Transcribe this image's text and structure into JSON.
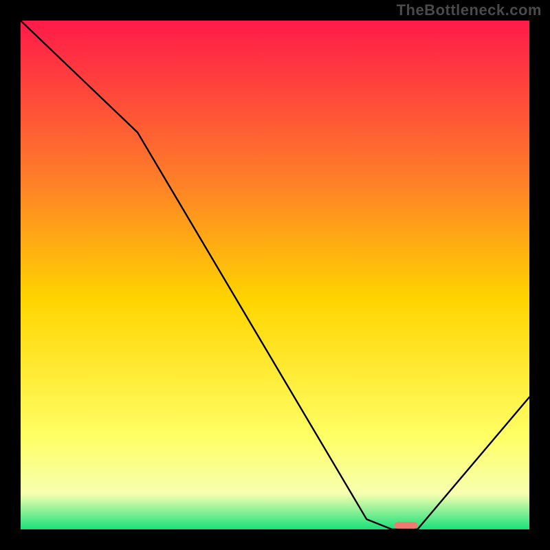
{
  "watermark": "TheBottleneck.com",
  "colors": {
    "background": "#000000",
    "line": "#000000",
    "marker": "#ef7a72",
    "gradient_top": "#ff1a4a",
    "gradient_upper": "#ff7a2a",
    "gradient_mid": "#ffd500",
    "gradient_lower": "#ffff66",
    "gradient_pale": "#f7ffb0",
    "gradient_bottom": "#19e07a"
  },
  "chart_data": {
    "type": "line",
    "title": "",
    "xlabel": "",
    "ylabel": "",
    "xlim": [
      0,
      100
    ],
    "ylim": [
      0,
      100
    ],
    "grid": false,
    "x": [
      0,
      23,
      68,
      73,
      78,
      100
    ],
    "values": [
      100,
      78,
      2,
      0,
      0,
      26
    ],
    "marker": {
      "x_range": [
        73.5,
        78
      ],
      "y": 0.8
    },
    "background_gradient_stops": [
      {
        "offset": 0.0,
        "color": "#ff1a4a"
      },
      {
        "offset": 0.3,
        "color": "#ff7a2a"
      },
      {
        "offset": 0.55,
        "color": "#ffd500"
      },
      {
        "offset": 0.82,
        "color": "#ffff66"
      },
      {
        "offset": 0.93,
        "color": "#f7ffb0"
      },
      {
        "offset": 1.0,
        "color": "#19e07a"
      }
    ]
  }
}
